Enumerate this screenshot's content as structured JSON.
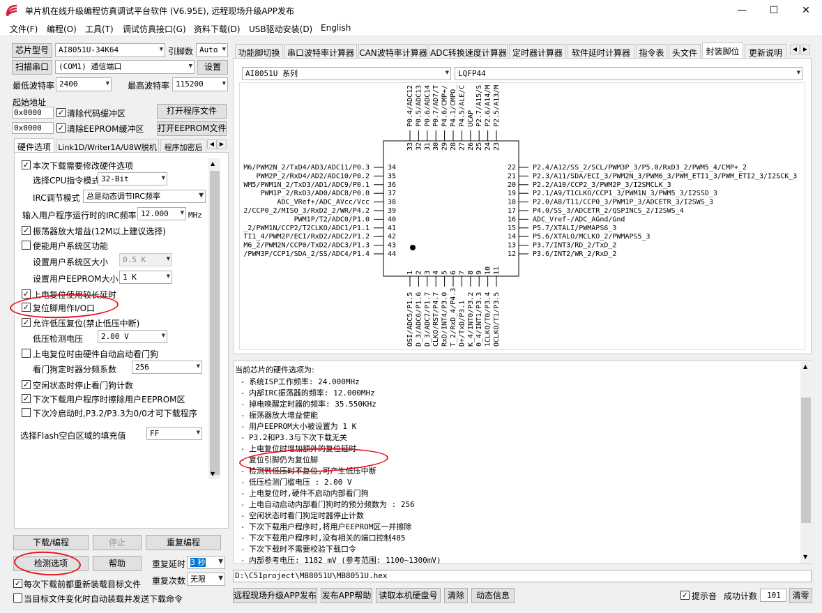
{
  "window": {
    "title": "单片机在线升级编程仿真调试平台软件 (V6.95E), 远程现场升级APP发布",
    "minimize": "—",
    "maximize": "☐",
    "close": "✕"
  },
  "menu": [
    {
      "label": "文件(F)"
    },
    {
      "label": "编程(O)"
    },
    {
      "label": "工具(T)"
    },
    {
      "label": "调试仿真接口(G)"
    },
    {
      "label": "资料下载(D)"
    },
    {
      "label": "USB驱动安装(D)"
    },
    {
      "label": "English"
    }
  ],
  "left": {
    "chip_model_btn": "芯片型号",
    "chip_model": "AI8051U-34K64",
    "pin_count_label": "引脚数",
    "pin_count": "Auto",
    "scan_port_btn": "扫描串口",
    "port": "(COM1) 通信端口",
    "settings_btn": "设置",
    "min_baud_label": "最低波特率",
    "min_baud": "2400",
    "max_baud_label": "最高波特率",
    "max_baud": "115200",
    "start_addr_label": "起始地址",
    "addr1": "0x0000",
    "clear_code_cb": "清除代码缓冲区",
    "open_prog_btn": "打开程序文件",
    "addr2": "0x0000",
    "clear_eeprom_cb": "清除EEPROM缓冲区",
    "open_eeprom_btn": "打开EEPROM文件",
    "tabs": [
      "硬件选项",
      "Link1D/Writer1A/U8W脱机",
      "程序加密后"
    ],
    "hw": {
      "opt_modify": "本次下载需要修改硬件选项",
      "cpu_mode_label": "选择CPU指令模式",
      "cpu_mode": "32-Bit",
      "irc_mode_label": "IRC调节模式",
      "irc_mode": "总是动态调节IRC频率",
      "irc_freq_label": "输入用户程序运行时的IRC频率",
      "irc_freq": "12.000",
      "irc_unit": "MHz",
      "osc_gain": "振荡器放大增益(12M以上建议选择)",
      "sys_area": "使能用户系统区功能",
      "sys_size_label": "设置用户系统区大小",
      "sys_size": "0.5 K",
      "eeprom_size_label": "设置用户EEPROM大小",
      "eeprom_size": "1  K",
      "power_delay": "上电复位使用较长延时",
      "reset_io": "复位脚用作I/O口",
      "lvr": "允许低压复位(禁止低压中断)",
      "lvd_label": "低压检测电压",
      "lvd": "2.00 V",
      "wdt_auto": "上电复位时由硬件自动启动看门狗",
      "wdt_div_label": "看门狗定时器分频系数",
      "wdt_div": "256",
      "idle_wdt": "空闲状态时停止看门狗计数",
      "erase_eeprom": "下次下载用户程序时擦除用户EEPROM区",
      "cold_p32": "下次冷启动时,P3.2/P3.3为0/0才可下载程序",
      "flash_fill_label": "选择Flash空白区域的填充值",
      "flash_fill": "FF"
    },
    "download_btn": "下载/编程",
    "stop_btn": "停止",
    "reprogram_btn": "重复编程",
    "check_btn": "检测选项",
    "help_btn": "帮助",
    "repeat_delay_label": "重复延时",
    "repeat_delay": "3 秒",
    "repeat_count_label": "重复次数",
    "repeat_count": "无限",
    "reload_cb": "每次下载前都重新装载目标文件",
    "auto_load_cb": "当目标文件变化时自动装载并发送下载命令"
  },
  "right": {
    "tabs": [
      "功能脚切换",
      "串口波特率计算器",
      "CAN波特率计算器",
      "ADC转换速度计算器",
      "定时器计算器",
      "软件延时计算器",
      "指令表",
      "头文件",
      "封装脚位",
      "更新说明"
    ],
    "series": "AI8051U 系列",
    "package": "LQFP44",
    "pins": {
      "top": [
        {
          "num": "33",
          "label": "P0.4/ADC12"
        },
        {
          "num": "32",
          "label": "P0.5/ADC13"
        },
        {
          "num": "31",
          "label": "P0.6/ADC14"
        },
        {
          "num": "30",
          "label": "P0.7/AD7/T"
        },
        {
          "num": "29",
          "label": "P4.6/CMP+/"
        },
        {
          "num": "28",
          "label": "P4.1/CMPO_"
        },
        {
          "num": "27",
          "label": "P4.5/ALE/C"
        },
        {
          "num": "26",
          "label": "UCAP"
        },
        {
          "num": "25",
          "label": "P2.7/A15/S"
        },
        {
          "num": "24",
          "label": "P2.6/A14/M"
        },
        {
          "num": "23",
          "label": "P2.5/A13/M"
        }
      ],
      "left": [
        {
          "num": "34",
          "label": "M6/PWM2N_2/TxD4/AD3/ADC11/P0.3"
        },
        {
          "num": "35",
          "label": "PWM2P_2/RxD4/AD2/ADC10/P0.2"
        },
        {
          "num": "36",
          "label": "WM5/PWM1N_2/TxD3/AD1/ADC9/P0.1"
        },
        {
          "num": "37",
          "label": "PWM1P_2/RxD3/AD0/ADC8/P0.0"
        },
        {
          "num": "38",
          "label": "ADC_VRef+/ADC_AVcc/Vcc"
        },
        {
          "num": "39",
          "label": "2/CCP0_2/MISO_3/RxD2_2/WR/P4.2"
        },
        {
          "num": "40",
          "label": "PWM1P/T2/ADC0/P1.0"
        },
        {
          "num": "41",
          "label": "_2/PWM1N/CCP2/T2CLKO/ADC1/P1.1"
        },
        {
          "num": "42",
          "label": "TI1_4/PWM2P/ECI/RxD2/ADC2/P1.2"
        },
        {
          "num": "43",
          "label": "M6_2/PWM2N/CCP0/TxD2/ADC3/P1.3"
        },
        {
          "num": "44",
          "label": "/PWM3P/CCP1/SDA_2/SS/ADC4/P1.4"
        }
      ],
      "right": [
        {
          "num": "22",
          "label": "P2.4/A12/SS_2/SCL/PWM3P_3/P5.0/RxD3_2/PWM5_4/CMP+_2"
        },
        {
          "num": "21",
          "label": "P2.3/A11/SDA/ECI_3/PWM2N_3/PWM6_3/PWM_ETI1_3/PWM_ETI2_3/I2SCK_3"
        },
        {
          "num": "20",
          "label": "P2.2/A10/CCP2_3/PWM2P_3/I2SMCLK_3"
        },
        {
          "num": "19",
          "label": "P2.1/A9/T1CLKO/CCP1_3/PWM1N_3/PWM5_3/I2SSD_3"
        },
        {
          "num": "18",
          "label": "P2.0/A8/T11/CCP0_3/PWM1P_3/ADCETR_3/I2SWS_3"
        },
        {
          "num": "17",
          "label": "P4.0/SS_3/ADCETR_2/QSPINCS_2/I2SWS_4"
        },
        {
          "num": "16",
          "label": "ADC_Vref-/ADC_AGnd/Gnd"
        },
        {
          "num": "15",
          "label": "P5.7/XTALI/PWMAPS6_3"
        },
        {
          "num": "14",
          "label": "P5.6/XTALO/MCLKO_2/PWMAPS5_3"
        },
        {
          "num": "13",
          "label": "P3.7/INT3/RD_2/TxD_2"
        },
        {
          "num": "12",
          "label": "P3.6/INT2/WR_2/RxD_2"
        }
      ],
      "bottom": [
        {
          "num": "1",
          "label": "OSI/ADC5/P1.5"
        },
        {
          "num": "2",
          "label": "D_3/ADC6/P1.6"
        },
        {
          "num": "3",
          "label": "D_3/ADC7/P1.7"
        },
        {
          "num": "4",
          "label": "CLKO/RST/P4.7"
        },
        {
          "num": "5",
          "label": "RxD/INT4/P3.0"
        },
        {
          "num": "6",
          "label": "T_2/RxD_4/P4.3"
        },
        {
          "num": "7",
          "label": "D+/TxD/P3.1"
        },
        {
          "num": "8",
          "label": "K_4/INT0/P3.2"
        },
        {
          "num": "9",
          "label": "0_4/INT1/P3.3"
        },
        {
          "num": "10",
          "label": "1CLKO/T0/P3.4"
        },
        {
          "num": "11",
          "label": "OCLKO/T1/P3.5"
        }
      ]
    },
    "status_header": "当前芯片的硬件选项为:",
    "status_lines": [
      "系统ISP工作频率: 24.000MHz",
      "内部IRC振荡器的频率: 12.000MHz",
      "掉电唤醒定时器的频率: 35.550KHz",
      "振荡器放大增益使能",
      "用户EEPROM大小被设置为 1 K",
      "P3.2和P3.3与下次下载无关",
      "上电复位时增加额外的复位延时",
      "复位引脚仍为复位脚",
      "检测到低压时不复位,可产生低压中断",
      "低压检测门槛电压 : 2.00 V",
      "上电复位时,硬件不启动内部看门狗",
      "上电自动启动内部看门狗时的预分频数为 : 256",
      "空闲状态时看门狗定时器停止计数",
      "下次下载用户程序时,将用户EEPROM区一并擦除",
      "下次下载用户程序时,没有相关的端口控制485",
      "下次下载时不需要校验下载口令",
      "内部参考电压: 1182 mV (参考范围: 1100~1300mV)"
    ],
    "file_path": "D:\\C51project\\MB8051U\\MB8051U.hex",
    "bottom_btns": [
      "远程现场升级APP发布",
      "发布APP帮助",
      "读取本机硬盘号",
      "清除",
      "动态信息"
    ],
    "beep_cb": "提示音",
    "success_label": "成功计数",
    "success_count": "101",
    "clear_count_btn": "清零"
  },
  "colors": {
    "highlight": "#e8141c",
    "selection": "#0078d7"
  }
}
